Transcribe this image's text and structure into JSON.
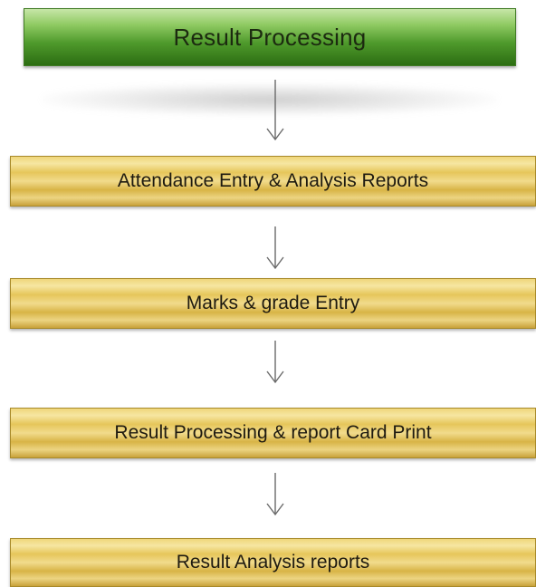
{
  "diagram": {
    "header": {
      "label": "Result Processing",
      "color": "#4f9a2c"
    },
    "steps": [
      {
        "label": "Attendance Entry & Analysis Reports"
      },
      {
        "label": "Marks & grade Entry"
      },
      {
        "label": "Result Processing & report Card Print"
      },
      {
        "label": "Result Analysis reports"
      }
    ],
    "step_color": "#e6c65a",
    "arrow_icon": "arrow-down-icon"
  }
}
